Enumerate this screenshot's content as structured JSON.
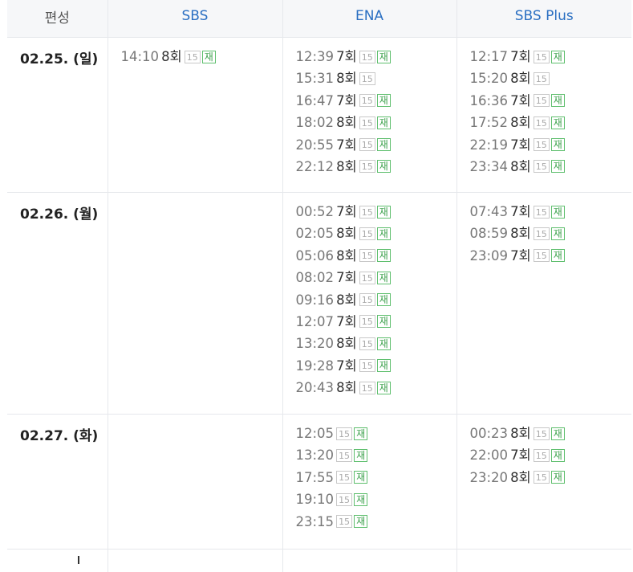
{
  "header": {
    "col0": "편성",
    "col1": "SBS",
    "col2": "ENA",
    "col3": "SBS Plus"
  },
  "badges": {
    "age": "15",
    "rerun": "재"
  },
  "rows": [
    {
      "date": "02.25. (일)",
      "sbs": [
        {
          "time": "14:10",
          "ep": "8회",
          "age": true,
          "re": true
        }
      ],
      "ena": [
        {
          "time": "12:39",
          "ep": "7회",
          "age": true,
          "re": true
        },
        {
          "time": "15:31",
          "ep": "8회",
          "age": true,
          "re": false
        },
        {
          "time": "16:47",
          "ep": "7회",
          "age": true,
          "re": true
        },
        {
          "time": "18:02",
          "ep": "8회",
          "age": true,
          "re": true
        },
        {
          "time": "20:55",
          "ep": "7회",
          "age": true,
          "re": true
        },
        {
          "time": "22:12",
          "ep": "8회",
          "age": true,
          "re": true
        }
      ],
      "plus": [
        {
          "time": "12:17",
          "ep": "7회",
          "age": true,
          "re": true
        },
        {
          "time": "15:20",
          "ep": "8회",
          "age": true,
          "re": false
        },
        {
          "time": "16:36",
          "ep": "7회",
          "age": true,
          "re": true
        },
        {
          "time": "17:52",
          "ep": "8회",
          "age": true,
          "re": true
        },
        {
          "time": "22:19",
          "ep": "7회",
          "age": true,
          "re": true
        },
        {
          "time": "23:34",
          "ep": "8회",
          "age": true,
          "re": true
        }
      ]
    },
    {
      "date": "02.26. (월)",
      "sbs": [],
      "ena": [
        {
          "time": "00:52",
          "ep": "7회",
          "age": true,
          "re": true
        },
        {
          "time": "02:05",
          "ep": "8회",
          "age": true,
          "re": true
        },
        {
          "time": "05:06",
          "ep": "8회",
          "age": true,
          "re": true
        },
        {
          "time": "08:02",
          "ep": "7회",
          "age": true,
          "re": true
        },
        {
          "time": "09:16",
          "ep": "8회",
          "age": true,
          "re": true
        },
        {
          "time": "12:07",
          "ep": "7회",
          "age": true,
          "re": true
        },
        {
          "time": "13:20",
          "ep": "8회",
          "age": true,
          "re": true
        },
        {
          "time": "19:28",
          "ep": "7회",
          "age": true,
          "re": true
        },
        {
          "time": "20:43",
          "ep": "8회",
          "age": true,
          "re": true
        }
      ],
      "plus": [
        {
          "time": "07:43",
          "ep": "7회",
          "age": true,
          "re": true
        },
        {
          "time": "08:59",
          "ep": "8회",
          "age": true,
          "re": true
        },
        {
          "time": "23:09",
          "ep": "7회",
          "age": true,
          "re": true
        }
      ]
    },
    {
      "date": "02.27. (화)",
      "sbs": [],
      "ena": [
        {
          "time": "12:05",
          "ep": "",
          "age": true,
          "re": true
        },
        {
          "time": "13:20",
          "ep": "",
          "age": true,
          "re": true
        },
        {
          "time": "17:55",
          "ep": "",
          "age": true,
          "re": true
        },
        {
          "time": "19:10",
          "ep": "",
          "age": true,
          "re": true
        },
        {
          "time": "23:15",
          "ep": "",
          "age": true,
          "re": true
        }
      ],
      "plus": [
        {
          "time": "00:23",
          "ep": "8회",
          "age": true,
          "re": true
        },
        {
          "time": "22:00",
          "ep": "7회",
          "age": true,
          "re": true
        },
        {
          "time": "23:20",
          "ep": "8회",
          "age": true,
          "re": true
        }
      ]
    }
  ]
}
